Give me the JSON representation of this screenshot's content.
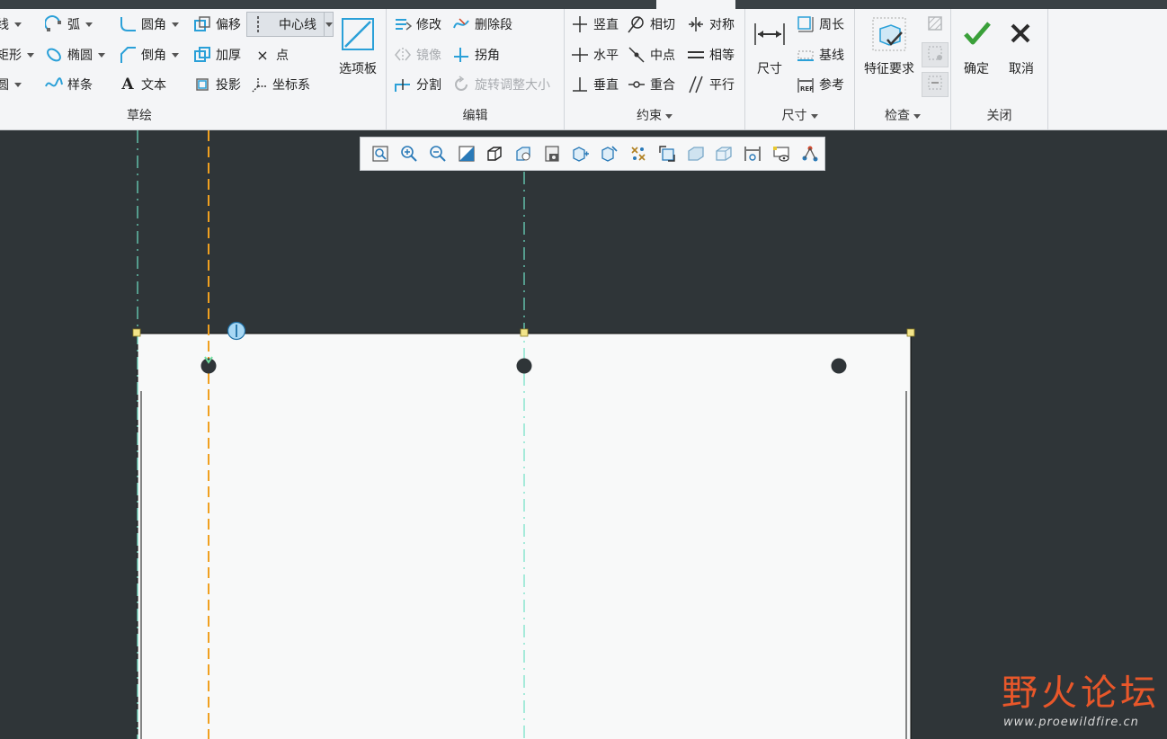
{
  "ribbon": {
    "sketch": {
      "label": "草绘",
      "line": "线",
      "rect": "矩形",
      "circle": "圆",
      "arc": "弧",
      "ellipse": "椭圆",
      "spline": "样条",
      "fillet": "圆角",
      "chamfer": "倒角",
      "text": "文本",
      "offset": "偏移",
      "thicken": "加厚",
      "project": "投影",
      "centerline": "中心线",
      "point": "点",
      "coordsys": "坐标系",
      "palette": "选项板"
    },
    "edit": {
      "label": "编辑",
      "modify": "修改",
      "delete_segment": "删除段",
      "mirror": "镜像",
      "corner": "拐角",
      "divide": "分割",
      "rotate_resize": "旋转调整大小"
    },
    "constrain": {
      "label": "约束",
      "vertical": "竖直",
      "tangent": "相切",
      "symmetric": "对称",
      "horizontal": "水平",
      "midpoint": "中点",
      "equal": "相等",
      "perpendicular": "垂直",
      "coincident": "重合",
      "parallel": "平行"
    },
    "dimension": {
      "label": "尺寸",
      "dimension": "尺寸",
      "perimeter": "周长",
      "baseline": "基线",
      "reference": "参考"
    },
    "inspect": {
      "label": "检查",
      "feature_requirements": "特征要求"
    },
    "close": {
      "label": "关闭",
      "ok": "确定",
      "cancel": "取消"
    }
  },
  "watermark": {
    "text": "野火论坛",
    "url": "www.proewildfire.cn"
  },
  "colors": {
    "canvas_bg": "#2f3538",
    "sheet": "#f8f9f9",
    "centerline_cyan": "#6fe0c6",
    "centerline_orange": "#f0a020",
    "accent_blue": "#2aa0d8",
    "ok_green": "#3aa03a"
  }
}
